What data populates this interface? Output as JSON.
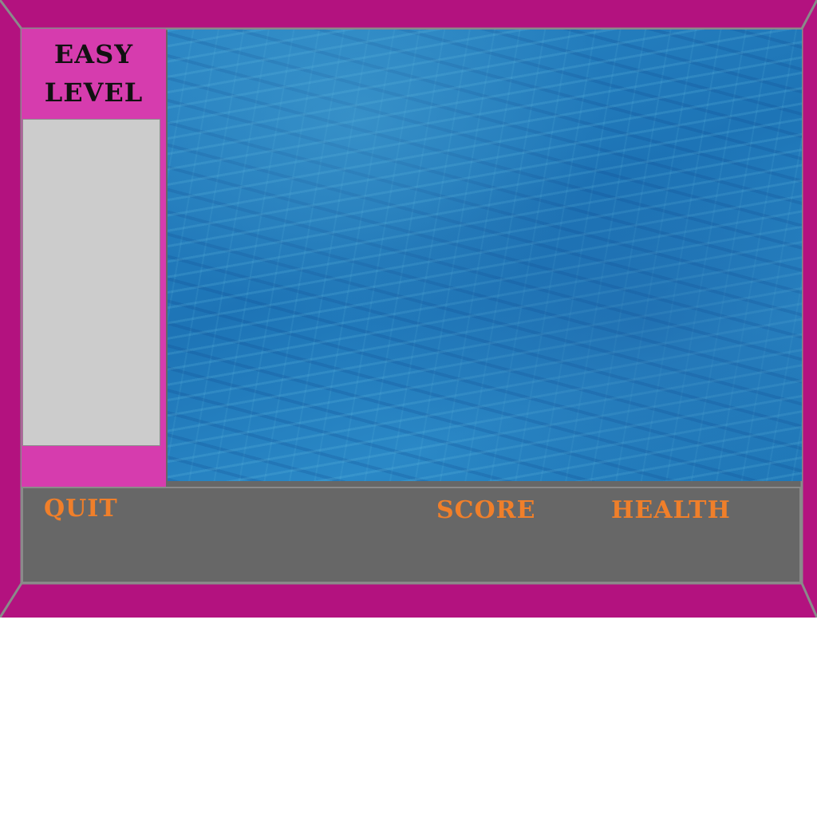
{
  "level": {
    "title_line1": "EASY",
    "title_line2": "LEVEL"
  },
  "hud": {
    "quit_label": "QUIT",
    "score_label": "SCORE",
    "health_label": "HEALTH"
  },
  "colors": {
    "frame": "#b3127f",
    "panel": "#d63cae",
    "slot": "#cccccc",
    "bar": "#676767",
    "hud_text": "#f07f2a",
    "water": "#1f78b8"
  }
}
